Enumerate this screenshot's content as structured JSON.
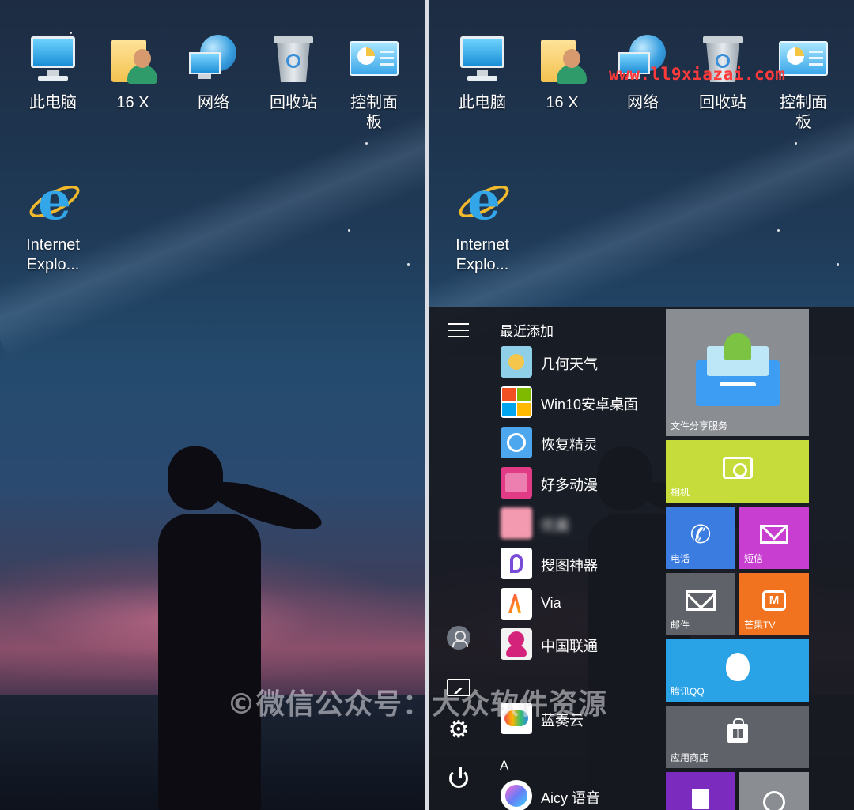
{
  "desktop": {
    "icons": [
      {
        "label": "此电脑",
        "icon": "this-pc-icon"
      },
      {
        "label": "16 X",
        "icon": "user-folder-icon"
      },
      {
        "label": "网络",
        "icon": "network-icon"
      },
      {
        "label": "回收站",
        "icon": "recycle-bin-icon"
      },
      {
        "label": "控制面板",
        "icon": "control-panel-icon"
      },
      {
        "label": "Internet Explo...",
        "icon": "internet-explorer-icon"
      }
    ]
  },
  "site_watermark": "www.ll9xiazai.com",
  "overlay_watermark": "©微信公众号：大众软件资源",
  "start_menu": {
    "recent_header": "最近添加",
    "apps": [
      {
        "name": "几何天气",
        "color": "#8fd0e8"
      },
      {
        "name": "Win10安卓桌面",
        "color": "#ffffff"
      },
      {
        "name": "恢复精灵",
        "color": "#4da7ee"
      },
      {
        "name": "好多动漫",
        "color": "#e23b86"
      },
      {
        "name": "优酱",
        "color": "#f39ab0",
        "blurred": true
      },
      {
        "name": "搜图神器",
        "color": "#ffffff"
      },
      {
        "name": "Via",
        "color": "#ffffff"
      },
      {
        "name": "中国联通",
        "color": "#f2f2f2"
      },
      {
        "name": "蓝奏云",
        "color": "#ffffff"
      },
      {
        "name": "Aicy 语音",
        "color": "#6a7cf5"
      }
    ],
    "section_letter": "A",
    "tiles": [
      {
        "name": "文件分享服务",
        "color": "#8a8d92"
      },
      {
        "name": "相机",
        "color": "#c6dc3a"
      },
      {
        "name": "电话",
        "color": "#3a7ce0"
      },
      {
        "name": "短信",
        "color": "#c73ed1"
      },
      {
        "name": "邮件",
        "color": "#5f6369"
      },
      {
        "name": "芒果TV",
        "color": "#f2731f"
      },
      {
        "name": "腾讯QQ",
        "color": "#2aa3e6"
      },
      {
        "name": "应用商店",
        "color": "#5f6369"
      }
    ]
  }
}
